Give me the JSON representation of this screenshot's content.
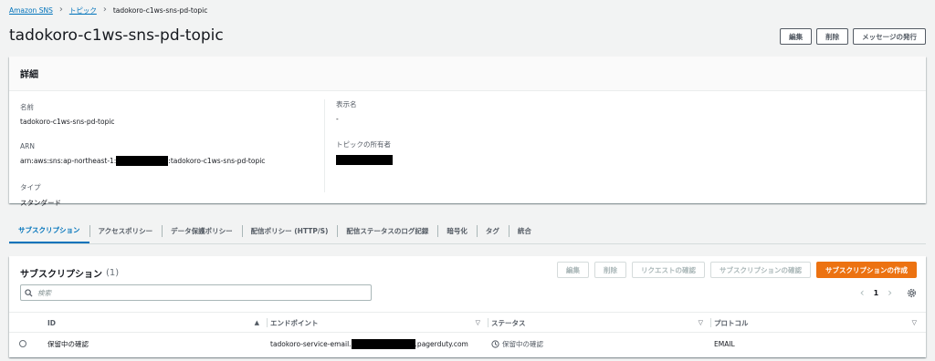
{
  "breadcrumb": {
    "root": "Amazon SNS",
    "parent": "トピック",
    "current": "tadokoro-c1ws-sns-pd-topic"
  },
  "page": {
    "title": "tadokoro-c1ws-sns-pd-topic",
    "actions": {
      "edit": "編集",
      "delete": "削除",
      "publish": "メッセージの発行"
    }
  },
  "details": {
    "heading": "詳細",
    "name_label": "名前",
    "name_value": "tadokoro-c1ws-sns-pd-topic",
    "arn_label": "ARN",
    "arn_prefix": "arn:aws:sns:ap-northeast-1:",
    "arn_suffix": ":tadokoro-c1ws-sns-pd-topic",
    "type_label": "タイプ",
    "type_value": "スタンダード",
    "display_name_label": "表示名",
    "display_name_value": "-",
    "owner_label": "トピックの所有者"
  },
  "tabs": [
    "サブスクリプション",
    "アクセスポリシー",
    "データ保護ポリシー",
    "配信ポリシー (HTTP/S)",
    "配信ステータスのログ記録",
    "暗号化",
    "タグ",
    "統合"
  ],
  "subscriptions": {
    "title": "サブスクリプション",
    "count": "(1)",
    "actions": {
      "edit": "編集",
      "delete": "削除",
      "request_confirm": "リクエストの確認",
      "confirm": "サブスクリプションの確認",
      "create": "サブスクリプションの作成"
    },
    "search_placeholder": "検索",
    "page_number": "1",
    "columns": {
      "id": "ID",
      "endpoint": "エンドポイント",
      "status": "ステータス",
      "protocol": "プロトコル"
    },
    "rows": [
      {
        "id": "保留中の確認",
        "endpoint_prefix": "tadokoro-service-email.",
        "endpoint_suffix": ".pagerduty.com",
        "status": "保留中の確認",
        "protocol": "EMAIL"
      }
    ]
  },
  "colors": {
    "link": "#0073bb",
    "primary_button": "#ec7211",
    "background": "#f2f3f3"
  }
}
